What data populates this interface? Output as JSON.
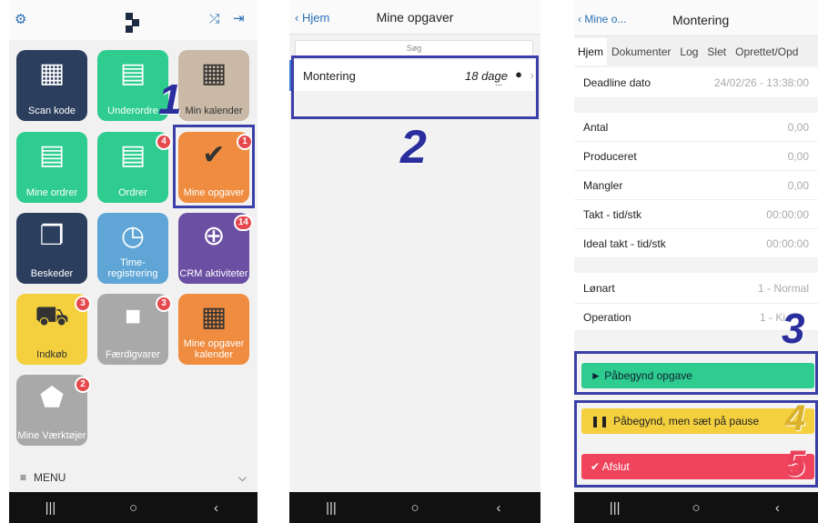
{
  "panel1": {
    "tiles": [
      {
        "label": "Scan kode",
        "icon": "qr-code-icon",
        "color": "#2c3e5e"
      },
      {
        "label": "Underordre",
        "icon": "document-icon",
        "color": "#2ecc8f"
      },
      {
        "label": "Min kalender",
        "icon": "calendar-icon",
        "color": "#c9b9a6"
      },
      {
        "label": "Mine ordrer",
        "icon": "document-icon",
        "color": "#2ecc8f"
      },
      {
        "label": "Ordrer",
        "icon": "document-icon",
        "color": "#2ecc8f",
        "badge": "4"
      },
      {
        "label": "Mine opgaver",
        "icon": "checkmark-icon",
        "color": "#ef8c3f",
        "badge": "1"
      },
      {
        "label": "Beskeder",
        "icon": "chat-icon",
        "color": "#2c3e5e"
      },
      {
        "label": "Time-registrering",
        "icon": "clock-icon",
        "color": "#5fa6d6"
      },
      {
        "label": "CRM aktiviteter",
        "icon": "crosshair-icon",
        "color": "#6b4fa3",
        "badge": "14"
      },
      {
        "label": "Indkøb",
        "icon": "cart-icon",
        "color": "#f4d03f",
        "badge": "3"
      },
      {
        "label": "Færdigvarer",
        "icon": "box-icon",
        "color": "#a9a9a9",
        "badge": "3"
      },
      {
        "label": "Mine opgaver kalender",
        "icon": "calendar-icon",
        "color": "#ef8c3f"
      },
      {
        "label": "Mine Værktøjer",
        "icon": "tag-icon",
        "color": "#a9a9a9",
        "badge": "2"
      }
    ],
    "menu_label": "MENU",
    "step": "1"
  },
  "panel2": {
    "back_label": "Hjem",
    "title": "Mine opgaver",
    "search_placeholder": "Søg",
    "task_name": "Montering",
    "task_days": "18 dage",
    "task_more": "...",
    "step": "2"
  },
  "panel3": {
    "back_label": "Mine o...",
    "title": "Montering",
    "tabs": [
      "Hjem",
      "Dokumenter",
      "Log",
      "Slet",
      "Oprettet/Opd"
    ],
    "deadline_label": "Deadline dato",
    "deadline_value": "24/02/26 - 13:38:00",
    "fields": [
      {
        "label": "Antal",
        "value": "0,00"
      },
      {
        "label": "Produceret",
        "value": "0,00"
      },
      {
        "label": "Mangler",
        "value": "0,00"
      },
      {
        "label": "Takt - tid/stk",
        "value": "00:00:00"
      },
      {
        "label": "Ideal takt - tid/stk",
        "value": "00:00:00"
      }
    ],
    "lonart_label": "Lønart",
    "lonart_value": "1 - Normal",
    "operation_label": "Operation",
    "operation_value": "1 - Ki",
    "start_button": "► Påbegynd opgave",
    "pause_button": "Påbegynd, men sæt på pause",
    "finish_button": "✔ Afslut",
    "steps": [
      "3",
      "4",
      "5"
    ]
  },
  "colors": {
    "accent": "#3b3fa8",
    "green": "#2ecc8f",
    "yellow": "#f4d03f",
    "red": "#f0435c"
  }
}
